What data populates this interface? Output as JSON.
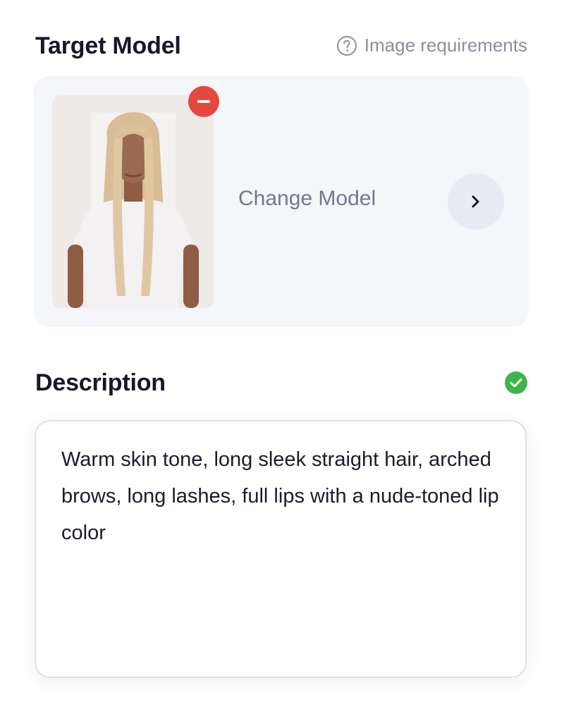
{
  "target_model": {
    "title": "Target Model",
    "requirements_link": "Image requirements",
    "help_icon": "question-circle-icon",
    "change_label": "Change Model",
    "next_icon": "chevron-right-icon",
    "remove_icon": "minus-circle-icon",
    "remove_color": "#e5483f"
  },
  "description": {
    "title": "Description",
    "status_icon": "check-circle-icon",
    "status_color": "#3db54a",
    "text": "Warm skin tone, long sleek straight hair, arched brows, long lashes, full lips with a nude-toned lip color"
  }
}
